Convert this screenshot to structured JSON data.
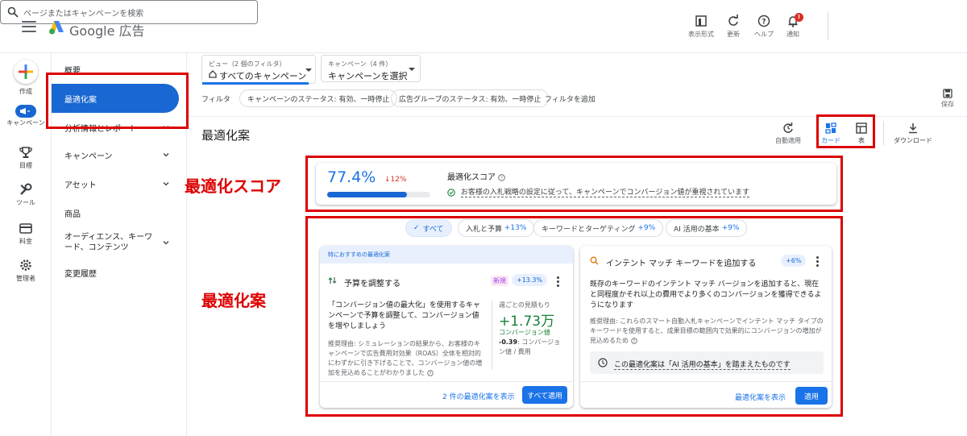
{
  "header": {
    "brand": "Google 広告",
    "search_placeholder": "ページまたはキャンペーンを検索",
    "tools": [
      {
        "label": "表示形式",
        "icon": "display-format-icon"
      },
      {
        "label": "更新",
        "icon": "refresh-icon"
      },
      {
        "label": "ヘルプ",
        "icon": "help-icon"
      },
      {
        "label": "通知",
        "icon": "bell-icon",
        "badge": "!"
      }
    ]
  },
  "rail": {
    "items": [
      {
        "label": "作成",
        "icon": "plus-icon"
      },
      {
        "label": "キャンペーン",
        "icon": "megaphone-icon"
      },
      {
        "label": "目標",
        "icon": "trophy-icon"
      },
      {
        "label": "ツール",
        "icon": "wrench-icon"
      },
      {
        "label": "料金",
        "icon": "credit-card-icon"
      },
      {
        "label": "管理者",
        "icon": "gear-icon"
      }
    ]
  },
  "sidenav": {
    "items": [
      {
        "label": "概要"
      },
      {
        "label": "最適化案",
        "active": true
      },
      {
        "label": "分析情報とレポート",
        "expandable": true
      },
      {
        "label": "キャンペーン",
        "expandable": true
      },
      {
        "label": "アセット",
        "expandable": true
      },
      {
        "label": "商品"
      },
      {
        "label": "オーディエンス、キーワード、コンテンツ",
        "expandable": true
      },
      {
        "label": "変更履歴"
      }
    ]
  },
  "view_selector": {
    "small": "ビュー（2 個のフィルタ）",
    "value": "すべてのキャンペーン"
  },
  "campaign_selector": {
    "small": "キャンペーン（4 件）",
    "value": "キャンペーンを選択"
  },
  "filters": {
    "label": "フィルタ",
    "chips": [
      "キャンペーンのステータス: 有効、一時停止",
      "広告グループのステータス: 有効、一時停止"
    ],
    "add": "フィルタを追加"
  },
  "save_label": "保存",
  "page_title": "最適化案",
  "toolbar": {
    "auto_apply": "自動適用",
    "cards": "カード",
    "table": "表",
    "download": "ダウンロード"
  },
  "annotations": {
    "score_label": "最適化スコア",
    "recs_label": "最適化案"
  },
  "score": {
    "value": "77.4%",
    "change": "↓12%",
    "progress": 0.774,
    "title": "最適化スコア",
    "note": "お客様の入札戦略の設定に従って、キャンペーンでコンバージョン値が重視されています"
  },
  "category_chips": [
    {
      "label": "すべて",
      "selected": true
    },
    {
      "label": "入札と予算",
      "delta": "+13%"
    },
    {
      "label": "キーワードとターゲティング",
      "delta": "+9%"
    },
    {
      "label": "AI 活用の基本",
      "delta": "+9%"
    }
  ],
  "card1": {
    "header": "特におすすめの最適化案",
    "title": "予算を調整する",
    "badge_new": "新規",
    "badge_delta": "+13.3%",
    "body": "「コンバージョン値の最大化」を使用するキャンペーンで予算を調整して、コンバージョン値を増やしましょう",
    "reason": "推奨理由: シミュレーションの結果から、お客様のキャンペーンで広告費用対効果（ROAS）全体を相対的にわずかに引き下げることで、コンバージョン値の増加を見込めることがわかりました",
    "est_label": "週ごとの見積もり",
    "est_value": "+1.73万",
    "est_metric": "コンバージョン値",
    "cost_value": "-0.39",
    "cost_label": ": コンバージョン値 / 費用",
    "link": "2 件の最適化案を表示",
    "button": "すべて適用"
  },
  "card2": {
    "title": "インテント マッチ キーワードを追加する",
    "badge_delta": "+6%",
    "body": "既存のキーワードのインテント マッチ バージョンを追加すると、現在と同程度かそれ以上の費用でより多くのコンバージョンを獲得できるようになります",
    "reason": "推奨理由: これらのスマート自動入札キャンペーンでインテント マッチ タイプのキーワードを使用すると、成果目標の範囲内で効果的にコンバージョンの増加が見込めるため",
    "ai_note": "この最適化案は「AI 活用の基本」を踏まえたものです",
    "link": "最適化案を表示",
    "button": "適用"
  },
  "colors": {
    "accent": "#1a73e8",
    "active_nav": "#1967d2",
    "annotation": "#dd0000",
    "positive": "#188038",
    "negative": "#d93025"
  }
}
